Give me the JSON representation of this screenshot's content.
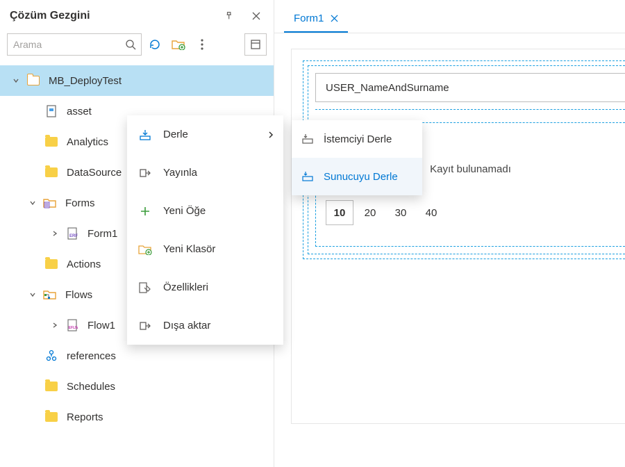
{
  "panel": {
    "title": "Çözüm Gezgini"
  },
  "search": {
    "placeholder": "Arama"
  },
  "tree": {
    "project": "MB_DeployTest",
    "asset": "asset",
    "analytics": "Analytics",
    "datasource": "DataSource",
    "forms": "Forms",
    "form1": "Form1",
    "actions": "Actions",
    "flows": "Flows",
    "flow1": "Flow1",
    "references": "references",
    "schedules": "Schedules",
    "reports": "Reports"
  },
  "ctx": {
    "compile": "Derle",
    "publish": "Yayınla",
    "newItem": "Yeni Öğe",
    "newFolder": "Yeni Klasör",
    "properties": "Özellikleri",
    "export": "Dışa aktar"
  },
  "subctx": {
    "client": "İstemciyi Derle",
    "server": "Sunucuyu Derle"
  },
  "tab": {
    "label": "Form1"
  },
  "form": {
    "field": "USER_NameAndSurname",
    "emptyMsg": "Kayıt bulunamadı",
    "pages": [
      "10",
      "20",
      "30",
      "40"
    ]
  }
}
